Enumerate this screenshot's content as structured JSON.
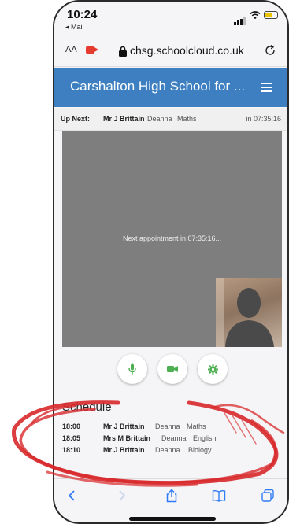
{
  "status_bar": {
    "time": "10:24",
    "back_label": "◂ Mail"
  },
  "browser": {
    "text_size_label": "AA",
    "url": "chsg.schoolcloud.co.uk"
  },
  "header": {
    "title": "Carshalton High School for ..."
  },
  "up_next": {
    "label": "Up Next:",
    "teacher": "Mr J Brittain",
    "student": "Deanna",
    "subject": "Maths",
    "eta": "in 07:35:16"
  },
  "video": {
    "message": "Next appointment in 07:35:16..."
  },
  "schedule": {
    "title": "Schedule",
    "rows": [
      {
        "time": "18:00",
        "teacher": "Mr J Brittain",
        "student": "Deanna",
        "subject": "Maths"
      },
      {
        "time": "18:05",
        "teacher": "Mrs M Brittain",
        "student": "Deanna",
        "subject": "English"
      },
      {
        "time": "18:10",
        "teacher": "Mr J Brittain",
        "student": "Deanna",
        "subject": "Biology"
      }
    ]
  },
  "colors": {
    "header_bg": "#3d7fc0",
    "control_green": "#4caf50",
    "annotation_red": "#d8282a"
  }
}
